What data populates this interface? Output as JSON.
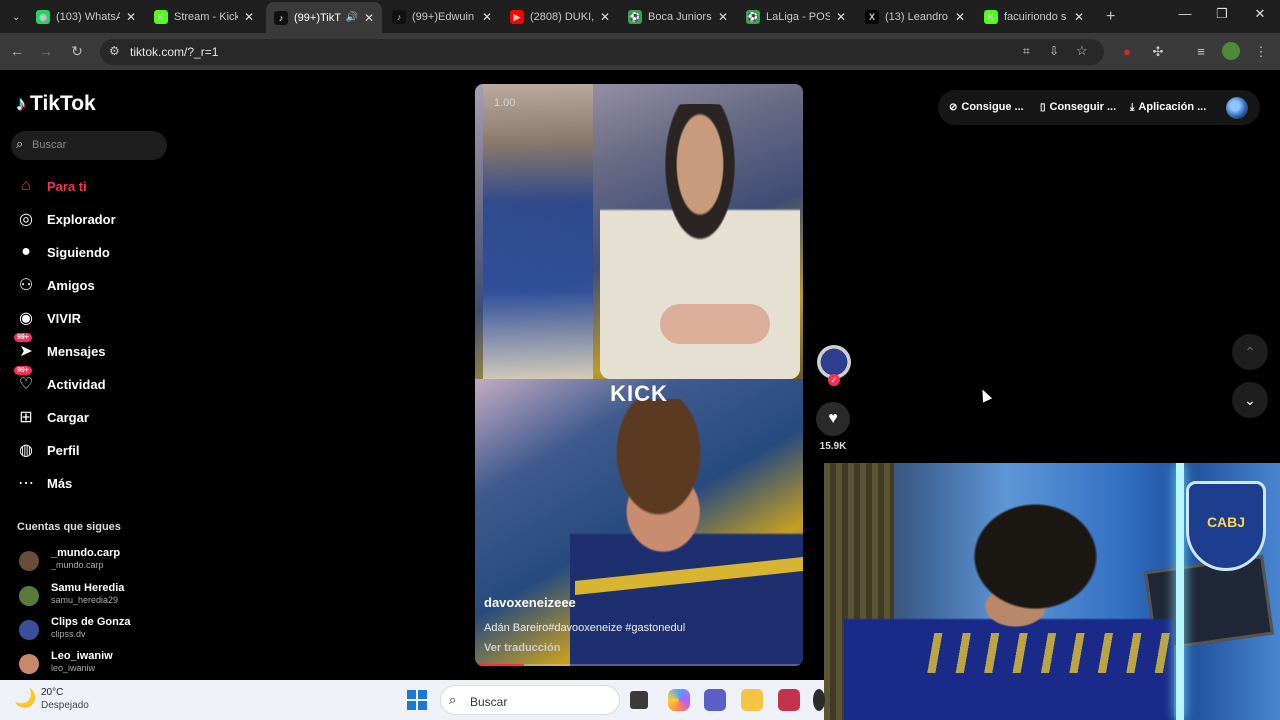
{
  "browser": {
    "tabs": [
      {
        "title": "(103) WhatsA",
        "color": "#25d366",
        "glyph": "◉"
      },
      {
        "title": "Stream - Kick",
        "color": "#53fc18",
        "glyph": "K"
      },
      {
        "title": "(99+)TikT",
        "color": "#111111",
        "glyph": "♪",
        "active": true,
        "audio": true
      },
      {
        "title": "(99+)Edwuin",
        "color": "#111111",
        "glyph": "♪"
      },
      {
        "title": "(2808) DUKI,",
        "color": "#ff0000",
        "glyph": "▶"
      },
      {
        "title": "Boca Juniors",
        "color": "#2fa84f",
        "glyph": "⚽"
      },
      {
        "title": "LaLiga - POSI",
        "color": "#2fa84f",
        "glyph": "⚽"
      },
      {
        "title": "(13) Leandro",
        "color": "#000000",
        "glyph": "X"
      },
      {
        "title": "facuiriondo s",
        "color": "#53fc18",
        "glyph": "K"
      }
    ],
    "url": "tiktok.com/?_r=1"
  },
  "sidebar": {
    "logo": "TikTok",
    "search_placeholder": "Buscar",
    "nav": [
      {
        "label": "Para ti",
        "icon": "home-icon",
        "active": true
      },
      {
        "label": "Explorador",
        "icon": "compass-icon"
      },
      {
        "label": "Siguiendo",
        "icon": "following-icon"
      },
      {
        "label": "Amigos",
        "icon": "friends-icon"
      },
      {
        "label": "VIVIR",
        "icon": "live-icon"
      },
      {
        "label": "Mensajes",
        "icon": "messages-icon",
        "badge": "99+"
      },
      {
        "label": "Actividad",
        "icon": "activity-icon",
        "badge": "99+"
      },
      {
        "label": "Cargar",
        "icon": "upload-icon"
      },
      {
        "label": "Perfil",
        "icon": "profile-icon"
      },
      {
        "label": "Más",
        "icon": "more-icon"
      }
    ],
    "following_title": "Cuentas que sigues",
    "accounts": [
      {
        "name": "_mundo.carp",
        "username": "_mundo.carp",
        "color": "#6b4b3a"
      },
      {
        "name": "Samu Heredia",
        "username": "samu_heredia29",
        "color": "#5a7a3a"
      },
      {
        "name": "Clips de Gonza",
        "username": "clipss.dv",
        "color": "#3a4f9a"
      },
      {
        "name": "Leo_iwaniw",
        "username": "leo_iwaniw",
        "color": "#c98a6a"
      }
    ]
  },
  "video": {
    "speed": "1.00",
    "kick_label": "KICK",
    "author": "davoxeneizeee",
    "caption": "Adán Bareiro#davooxeneize #gastonedul",
    "translate": "Ver traducción"
  },
  "actions": {
    "likes": "15.9K"
  },
  "topbar": {
    "items": [
      "Consigue ...",
      "Conseguir ...",
      "Aplicación ..."
    ]
  },
  "webcam": {
    "shield_text": "CABJ"
  },
  "taskbar": {
    "temperature": "20°C",
    "weather": "Despejado",
    "search_placeholder": "Buscar"
  }
}
